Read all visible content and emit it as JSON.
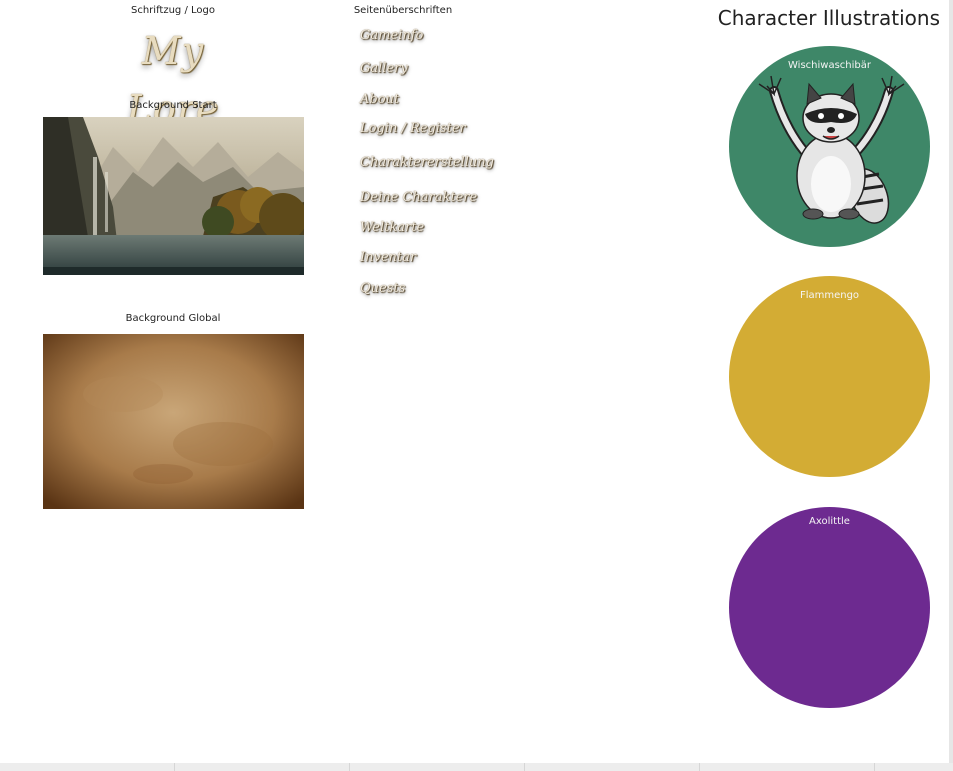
{
  "left_column": {
    "logo_caption": "Schriftzug / Logo",
    "logo_text": "My Lore",
    "bg_start_caption": "Background Start",
    "bg_global_caption": "Background Global"
  },
  "headings": {
    "caption": "Seitenüberschriften",
    "items": [
      "Gameinfo",
      "Gallery",
      "About",
      "Login / Register",
      "Charaktererstellung",
      "Deine Charaktere",
      "Weltkarte",
      "Inventar",
      "Quests"
    ]
  },
  "characters": {
    "title": "Character Illustrations",
    "items": [
      {
        "name": "Wischiwaschibär",
        "color": "#3e8768",
        "icon": "raccoon-illustration"
      },
      {
        "name": "Flammengo",
        "color": "#d3ac34"
      },
      {
        "name": "Axolittle",
        "color": "#6d2a90"
      }
    ]
  }
}
